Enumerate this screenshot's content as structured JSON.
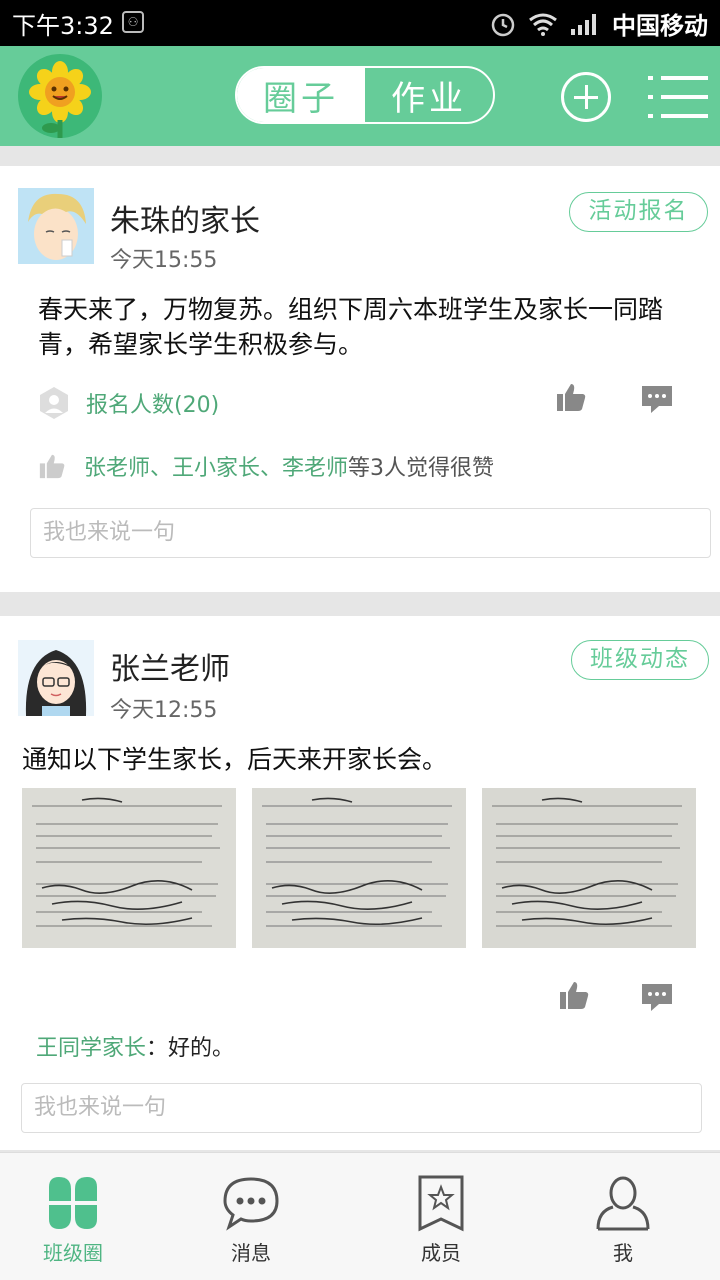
{
  "status_bar": {
    "time": "下午3:32",
    "carrier": "中国移动"
  },
  "header": {
    "tabs": [
      {
        "label": "圈子",
        "active": true
      },
      {
        "label": "作业",
        "active": false
      }
    ],
    "accent_color": "#66cc99"
  },
  "posts": [
    {
      "author": "朱珠的家长",
      "time": "今天15:55",
      "tag": "活动报名",
      "text": "春天来了，万物复苏。组织下周六本班学生及家长一同踏青，希望家长学生积极参与。",
      "registration": "报名人数(20)",
      "likers": "张老师、王小家长、李老师",
      "likes_suffix": "等3人觉得很赞",
      "comment_placeholder": "我也来说一句"
    },
    {
      "author": "张兰老师",
      "time": "今天12:55",
      "tag": "班级动态",
      "text": "通知以下学生家长，后天来开家长会。",
      "reply_author": "王同学家长",
      "reply_sep": "：",
      "reply_text": "好的。",
      "comment_placeholder": "我也来说一句"
    }
  ],
  "bottom_nav": [
    {
      "label": "班级圈",
      "icon": "clover-icon",
      "active": true
    },
    {
      "label": "消息",
      "icon": "chat-icon",
      "active": false
    },
    {
      "label": "成员",
      "icon": "members-star-icon",
      "active": false
    },
    {
      "label": "我",
      "icon": "person-icon",
      "active": false
    }
  ]
}
